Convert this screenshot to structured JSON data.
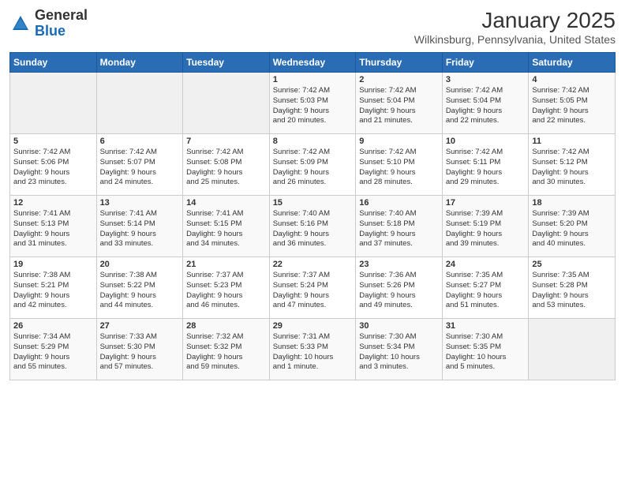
{
  "header": {
    "logo_general": "General",
    "logo_blue": "Blue",
    "title": "January 2025",
    "subtitle": "Wilkinsburg, Pennsylvania, United States"
  },
  "calendar": {
    "days_of_week": [
      "Sunday",
      "Monday",
      "Tuesday",
      "Wednesday",
      "Thursday",
      "Friday",
      "Saturday"
    ],
    "weeks": [
      [
        {
          "day": "",
          "detail": ""
        },
        {
          "day": "",
          "detail": ""
        },
        {
          "day": "",
          "detail": ""
        },
        {
          "day": "1",
          "detail": "Sunrise: 7:42 AM\nSunset: 5:03 PM\nDaylight: 9 hours\nand 20 minutes."
        },
        {
          "day": "2",
          "detail": "Sunrise: 7:42 AM\nSunset: 5:04 PM\nDaylight: 9 hours\nand 21 minutes."
        },
        {
          "day": "3",
          "detail": "Sunrise: 7:42 AM\nSunset: 5:04 PM\nDaylight: 9 hours\nand 22 minutes."
        },
        {
          "day": "4",
          "detail": "Sunrise: 7:42 AM\nSunset: 5:05 PM\nDaylight: 9 hours\nand 22 minutes."
        }
      ],
      [
        {
          "day": "5",
          "detail": "Sunrise: 7:42 AM\nSunset: 5:06 PM\nDaylight: 9 hours\nand 23 minutes."
        },
        {
          "day": "6",
          "detail": "Sunrise: 7:42 AM\nSunset: 5:07 PM\nDaylight: 9 hours\nand 24 minutes."
        },
        {
          "day": "7",
          "detail": "Sunrise: 7:42 AM\nSunset: 5:08 PM\nDaylight: 9 hours\nand 25 minutes."
        },
        {
          "day": "8",
          "detail": "Sunrise: 7:42 AM\nSunset: 5:09 PM\nDaylight: 9 hours\nand 26 minutes."
        },
        {
          "day": "9",
          "detail": "Sunrise: 7:42 AM\nSunset: 5:10 PM\nDaylight: 9 hours\nand 28 minutes."
        },
        {
          "day": "10",
          "detail": "Sunrise: 7:42 AM\nSunset: 5:11 PM\nDaylight: 9 hours\nand 29 minutes."
        },
        {
          "day": "11",
          "detail": "Sunrise: 7:42 AM\nSunset: 5:12 PM\nDaylight: 9 hours\nand 30 minutes."
        }
      ],
      [
        {
          "day": "12",
          "detail": "Sunrise: 7:41 AM\nSunset: 5:13 PM\nDaylight: 9 hours\nand 31 minutes."
        },
        {
          "day": "13",
          "detail": "Sunrise: 7:41 AM\nSunset: 5:14 PM\nDaylight: 9 hours\nand 33 minutes."
        },
        {
          "day": "14",
          "detail": "Sunrise: 7:41 AM\nSunset: 5:15 PM\nDaylight: 9 hours\nand 34 minutes."
        },
        {
          "day": "15",
          "detail": "Sunrise: 7:40 AM\nSunset: 5:16 PM\nDaylight: 9 hours\nand 36 minutes."
        },
        {
          "day": "16",
          "detail": "Sunrise: 7:40 AM\nSunset: 5:18 PM\nDaylight: 9 hours\nand 37 minutes."
        },
        {
          "day": "17",
          "detail": "Sunrise: 7:39 AM\nSunset: 5:19 PM\nDaylight: 9 hours\nand 39 minutes."
        },
        {
          "day": "18",
          "detail": "Sunrise: 7:39 AM\nSunset: 5:20 PM\nDaylight: 9 hours\nand 40 minutes."
        }
      ],
      [
        {
          "day": "19",
          "detail": "Sunrise: 7:38 AM\nSunset: 5:21 PM\nDaylight: 9 hours\nand 42 minutes."
        },
        {
          "day": "20",
          "detail": "Sunrise: 7:38 AM\nSunset: 5:22 PM\nDaylight: 9 hours\nand 44 minutes."
        },
        {
          "day": "21",
          "detail": "Sunrise: 7:37 AM\nSunset: 5:23 PM\nDaylight: 9 hours\nand 46 minutes."
        },
        {
          "day": "22",
          "detail": "Sunrise: 7:37 AM\nSunset: 5:24 PM\nDaylight: 9 hours\nand 47 minutes."
        },
        {
          "day": "23",
          "detail": "Sunrise: 7:36 AM\nSunset: 5:26 PM\nDaylight: 9 hours\nand 49 minutes."
        },
        {
          "day": "24",
          "detail": "Sunrise: 7:35 AM\nSunset: 5:27 PM\nDaylight: 9 hours\nand 51 minutes."
        },
        {
          "day": "25",
          "detail": "Sunrise: 7:35 AM\nSunset: 5:28 PM\nDaylight: 9 hours\nand 53 minutes."
        }
      ],
      [
        {
          "day": "26",
          "detail": "Sunrise: 7:34 AM\nSunset: 5:29 PM\nDaylight: 9 hours\nand 55 minutes."
        },
        {
          "day": "27",
          "detail": "Sunrise: 7:33 AM\nSunset: 5:30 PM\nDaylight: 9 hours\nand 57 minutes."
        },
        {
          "day": "28",
          "detail": "Sunrise: 7:32 AM\nSunset: 5:32 PM\nDaylight: 9 hours\nand 59 minutes."
        },
        {
          "day": "29",
          "detail": "Sunrise: 7:31 AM\nSunset: 5:33 PM\nDaylight: 10 hours\nand 1 minute."
        },
        {
          "day": "30",
          "detail": "Sunrise: 7:30 AM\nSunset: 5:34 PM\nDaylight: 10 hours\nand 3 minutes."
        },
        {
          "day": "31",
          "detail": "Sunrise: 7:30 AM\nSunset: 5:35 PM\nDaylight: 10 hours\nand 5 minutes."
        },
        {
          "day": "",
          "detail": ""
        }
      ]
    ]
  }
}
